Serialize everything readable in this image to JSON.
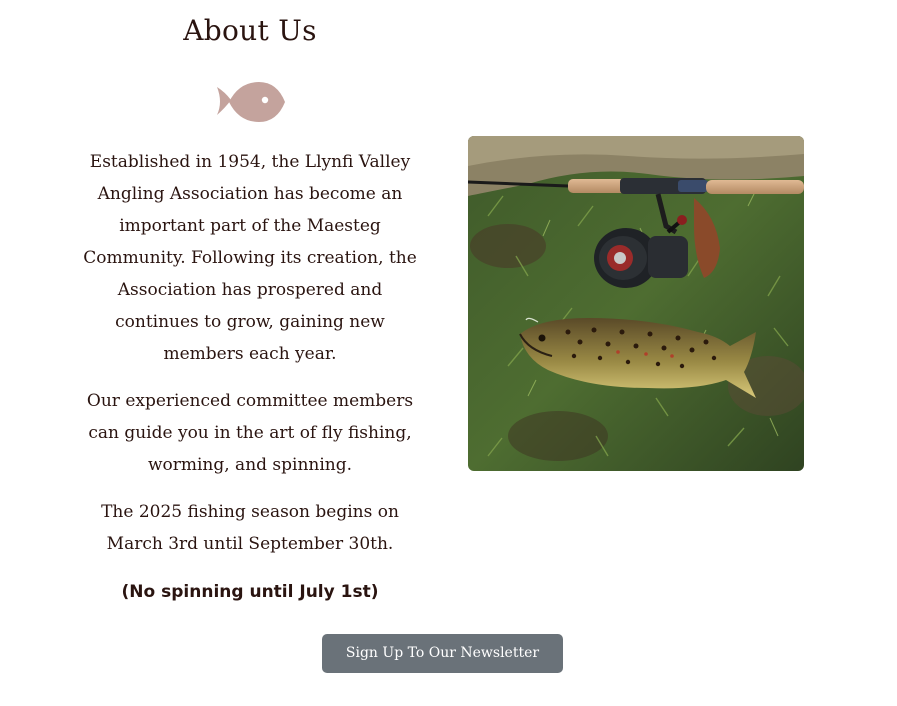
{
  "about": {
    "title": "About Us",
    "icon": "fish-icon",
    "icon_color": "#c4a39d",
    "paragraphs": [
      "Established in 1954, the Llynfi Valley Angling Association has become an important part of the Maesteg Community. Following its creation, the Association has prospered and continues to grow, gaining new members each year.",
      "Our experienced committee members can guide you in the art of fly fishing, worming, and spinning.",
      "The 2025 fishing season begins on March 3rd until September 30th.",
      "(No spinning until July 1st)"
    ]
  },
  "photo": {
    "subject": "trout-rod-and-reel-on-grass"
  },
  "newsletter": {
    "button_label": "Sign Up To Our Newsletter",
    "button_color": "#6a7279"
  }
}
